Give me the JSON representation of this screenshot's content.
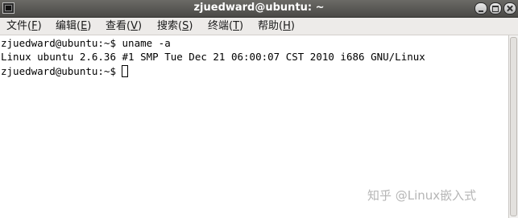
{
  "window": {
    "title": "zjuedward@ubuntu: ~",
    "controls": [
      "minimize",
      "maximize",
      "close"
    ]
  },
  "menubar": {
    "items": [
      {
        "label": "文件(",
        "mnemonic": "F",
        "suffix": ")"
      },
      {
        "label": "编辑(",
        "mnemonic": "E",
        "suffix": ")"
      },
      {
        "label": "查看(",
        "mnemonic": "V",
        "suffix": ")"
      },
      {
        "label": "搜索(",
        "mnemonic": "S",
        "suffix": ")"
      },
      {
        "label": "终端(",
        "mnemonic": "T",
        "suffix": ")"
      },
      {
        "label": "帮助(",
        "mnemonic": "H",
        "suffix": ")"
      }
    ]
  },
  "terminal": {
    "lines": [
      "zjuedward@ubuntu:~$ uname -a",
      "Linux ubuntu 2.6.36 #1 SMP Tue Dec 21 06:00:07 CST 2010 i686 GNU/Linux",
      "zjuedward@ubuntu:~$"
    ]
  },
  "watermark": "知乎 @Linux嵌入式"
}
